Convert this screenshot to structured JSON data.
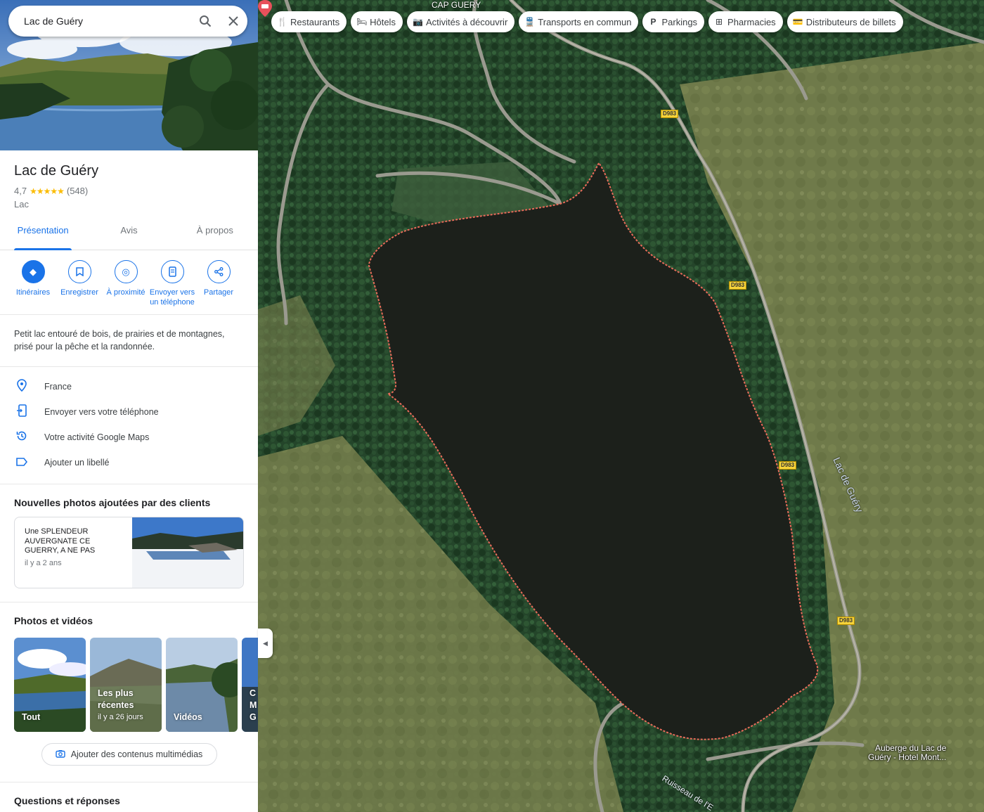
{
  "search": {
    "value": "Lac de Guéry"
  },
  "place": {
    "title": "Lac de Guéry",
    "rating": "4,7",
    "stars": "★★★★★",
    "reviews_count": "(548)",
    "category": "Lac",
    "description": "Petit lac entouré de bois, de prairies et de montagnes, prisé pour la pêche et la randonnée."
  },
  "tabs": [
    {
      "label": "Présentation",
      "active": true
    },
    {
      "label": "Avis",
      "active": false
    },
    {
      "label": "À propos",
      "active": false
    }
  ],
  "actions": [
    {
      "label": "Itinéraires",
      "icon": "directions-icon"
    },
    {
      "label": "Enregistrer",
      "icon": "bookmark-icon"
    },
    {
      "label": "À proximité",
      "icon": "nearby-icon"
    },
    {
      "label": "Envoyer vers un téléphone",
      "icon": "send-to-phone-icon"
    },
    {
      "label": "Partager",
      "icon": "share-icon"
    }
  ],
  "info": [
    {
      "text": "France",
      "icon": "location-pin-icon"
    },
    {
      "text": "Envoyer vers votre téléphone",
      "icon": "phone-icon"
    },
    {
      "text": "Votre activité Google Maps",
      "icon": "history-icon"
    },
    {
      "text": "Ajouter un libellé",
      "icon": "label-icon"
    }
  ],
  "new_photos": {
    "title": "Nouvelles photos ajoutées par des clients",
    "review_text": "Une SPLENDEUR AUVERGNATE CE GUERRY, A NE PAS",
    "review_time": "il y a 2 ans"
  },
  "media": {
    "title": "Photos et vidéos",
    "tiles": [
      {
        "label": "Tout",
        "sub": ""
      },
      {
        "label": "Les plus récentes",
        "sub": "il y a 26 jours"
      },
      {
        "label": "Vidéos",
        "sub": ""
      },
      {
        "label": "C M G",
        "sub": ""
      }
    ],
    "add_label": "Ajouter des contenus multimédias"
  },
  "qa_title": "Questions et réponses",
  "chips": [
    {
      "label": "Restaurants",
      "icon": "restaurant-icon"
    },
    {
      "label": "Hôtels",
      "icon": "hotel-icon"
    },
    {
      "label": "Activités à découvrir",
      "icon": "camera-icon"
    },
    {
      "label": "Transports en commun",
      "icon": "transit-icon"
    },
    {
      "label": "Parkings",
      "icon": "parking-icon"
    },
    {
      "label": "Pharmacies",
      "icon": "pharmacy-icon"
    },
    {
      "label": "Distributeurs de billets",
      "icon": "atm-icon"
    }
  ],
  "map": {
    "lake_label": "Lac de Guéry",
    "place_top": "CAP GUERY",
    "hotel_label_1": "Auberge du Lac de",
    "hotel_label_2": "Guéry - Hotel Mont...",
    "stream_label": "Ruisseau de l'E",
    "road_label": "D983",
    "accent_color": "#1a73e8",
    "boundary_color": "#e86b5a"
  }
}
